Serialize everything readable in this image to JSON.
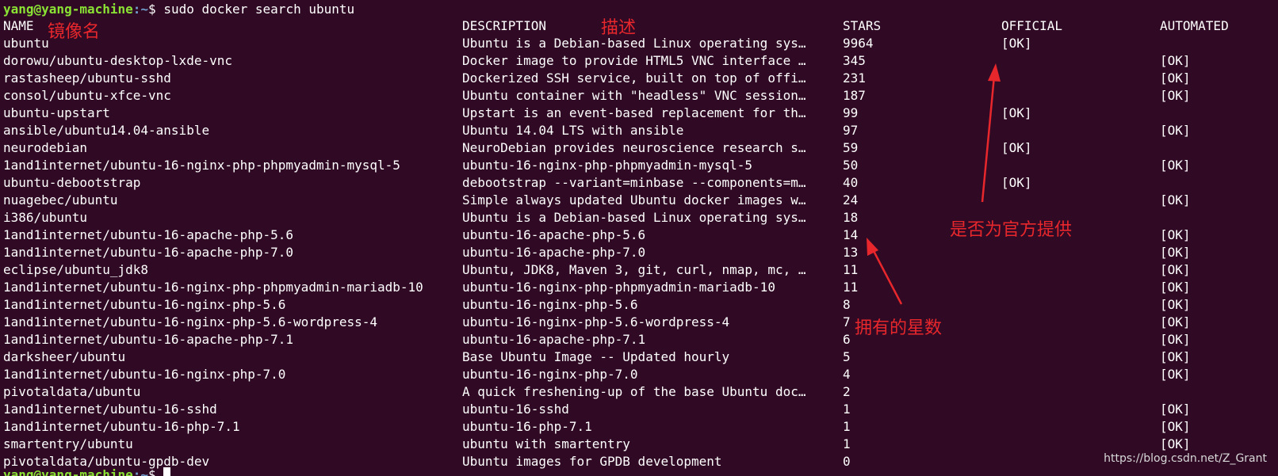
{
  "prompt": {
    "user_host": "yang@yang-machine",
    "path": ":~",
    "symbol": "$",
    "command": "sudo docker search ubuntu",
    "next_prompt_user": "yang@yang-machine"
  },
  "columns": {
    "name": "NAME",
    "description": "DESCRIPTION",
    "stars": "STARS",
    "official": "OFFICIAL",
    "automated": "AUTOMATED"
  },
  "rows": [
    {
      "name": "ubuntu",
      "description": "Ubuntu is a Debian-based Linux operating sys…",
      "stars": "9964",
      "official": "[OK]",
      "automated": ""
    },
    {
      "name": "dorowu/ubuntu-desktop-lxde-vnc",
      "description": "Docker image to provide HTML5 VNC interface …",
      "stars": "345",
      "official": "",
      "automated": "[OK]"
    },
    {
      "name": "rastasheep/ubuntu-sshd",
      "description": "Dockerized SSH service, built on top of offi…",
      "stars": "231",
      "official": "",
      "automated": "[OK]"
    },
    {
      "name": "consol/ubuntu-xfce-vnc",
      "description": "Ubuntu container with \"headless\" VNC session…",
      "stars": "187",
      "official": "",
      "automated": "[OK]"
    },
    {
      "name": "ubuntu-upstart",
      "description": "Upstart is an event-based replacement for th…",
      "stars": "99",
      "official": "[OK]",
      "automated": ""
    },
    {
      "name": "ansible/ubuntu14.04-ansible",
      "description": "Ubuntu 14.04 LTS with ansible",
      "stars": "97",
      "official": "",
      "automated": "[OK]"
    },
    {
      "name": "neurodebian",
      "description": "NeuroDebian provides neuroscience research s…",
      "stars": "59",
      "official": "[OK]",
      "automated": ""
    },
    {
      "name": "1and1internet/ubuntu-16-nginx-php-phpmyadmin-mysql-5",
      "description": "ubuntu-16-nginx-php-phpmyadmin-mysql-5",
      "stars": "50",
      "official": "",
      "automated": "[OK]"
    },
    {
      "name": "ubuntu-debootstrap",
      "description": "debootstrap --variant=minbase --components=m…",
      "stars": "40",
      "official": "[OK]",
      "automated": ""
    },
    {
      "name": "nuagebec/ubuntu",
      "description": "Simple always updated Ubuntu docker images w…",
      "stars": "24",
      "official": "",
      "automated": "[OK]"
    },
    {
      "name": "i386/ubuntu",
      "description": "Ubuntu is a Debian-based Linux operating sys…",
      "stars": "18",
      "official": "",
      "automated": ""
    },
    {
      "name": "1and1internet/ubuntu-16-apache-php-5.6",
      "description": "ubuntu-16-apache-php-5.6",
      "stars": "14",
      "official": "",
      "automated": "[OK]"
    },
    {
      "name": "1and1internet/ubuntu-16-apache-php-7.0",
      "description": "ubuntu-16-apache-php-7.0",
      "stars": "13",
      "official": "",
      "automated": "[OK]"
    },
    {
      "name": "eclipse/ubuntu_jdk8",
      "description": "Ubuntu, JDK8, Maven 3, git, curl, nmap, mc, …",
      "stars": "11",
      "official": "",
      "automated": "[OK]"
    },
    {
      "name": "1and1internet/ubuntu-16-nginx-php-phpmyadmin-mariadb-10",
      "description": "ubuntu-16-nginx-php-phpmyadmin-mariadb-10",
      "stars": "11",
      "official": "",
      "automated": "[OK]"
    },
    {
      "name": "1and1internet/ubuntu-16-nginx-php-5.6",
      "description": "ubuntu-16-nginx-php-5.6",
      "stars": "8",
      "official": "",
      "automated": "[OK]"
    },
    {
      "name": "1and1internet/ubuntu-16-nginx-php-5.6-wordpress-4",
      "description": "ubuntu-16-nginx-php-5.6-wordpress-4",
      "stars": "7",
      "official": "",
      "automated": "[OK]"
    },
    {
      "name": "1and1internet/ubuntu-16-apache-php-7.1",
      "description": "ubuntu-16-apache-php-7.1",
      "stars": "6",
      "official": "",
      "automated": "[OK]"
    },
    {
      "name": "darksheer/ubuntu",
      "description": "Base Ubuntu Image -- Updated hourly",
      "stars": "5",
      "official": "",
      "automated": "[OK]"
    },
    {
      "name": "1and1internet/ubuntu-16-nginx-php-7.0",
      "description": "ubuntu-16-nginx-php-7.0",
      "stars": "4",
      "official": "",
      "automated": "[OK]"
    },
    {
      "name": "pivotaldata/ubuntu",
      "description": "A quick freshening-up of the base Ubuntu doc…",
      "stars": "2",
      "official": "",
      "automated": ""
    },
    {
      "name": "1and1internet/ubuntu-16-sshd",
      "description": "ubuntu-16-sshd",
      "stars": "1",
      "official": "",
      "automated": "[OK]"
    },
    {
      "name": "1and1internet/ubuntu-16-php-7.1",
      "description": "ubuntu-16-php-7.1",
      "stars": "1",
      "official": "",
      "automated": "[OK]"
    },
    {
      "name": "smartentry/ubuntu",
      "description": "ubuntu with smartentry",
      "stars": "1",
      "official": "",
      "automated": "[OK]"
    },
    {
      "name": "pivotaldata/ubuntu-gpdb-dev",
      "description": "Ubuntu images for GPDB development",
      "stars": "0",
      "official": "",
      "automated": ""
    }
  ],
  "annotations": {
    "image_name": "镜像名",
    "description": "描述",
    "official": "是否为官方提供",
    "stars": "拥有的星数"
  },
  "watermark": "https://blog.csdn.net/Z_Grant",
  "colors": {
    "background": "#300a24",
    "prompt_user": "#8ae234",
    "prompt_path": "#729fcf",
    "annotation": "#e8272d"
  }
}
